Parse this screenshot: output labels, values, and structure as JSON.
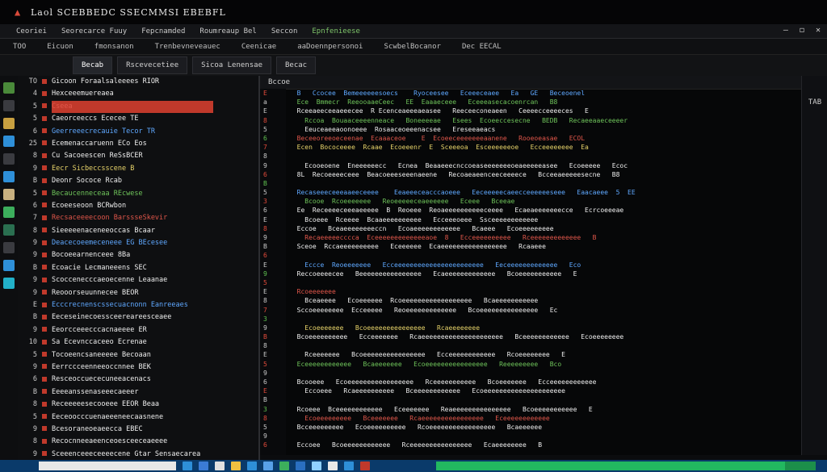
{
  "window": {
    "title": "Laol SCEBBEDC SSECMMSI EBEBFL"
  },
  "menubar": {
    "items": [
      "Ceoriei",
      "Seorecarce Fuuy",
      "Fepcnamded",
      "Roumreaup Bel",
      "Seccon",
      "Epnfenieese"
    ],
    "controls": [
      "—",
      "◻",
      "✕"
    ]
  },
  "toolbar": {
    "items": [
      "TOO",
      "Eicuon",
      "fmonsanon",
      "Trenbevneveauec",
      "Ceenicae",
      "aaDoennpersonoi",
      "ScwbelBocanor",
      "Dec EECAL"
    ]
  },
  "tabs": [
    {
      "label": "Becab",
      "active": true
    },
    {
      "label": "Rscevecetiee",
      "active": false
    },
    {
      "label": "Sicoa Lenensae",
      "active": false
    },
    {
      "label": "Becac",
      "active": false
    }
  ],
  "leftpanel": {
    "lines": [
      {
        "num": "TO",
        "text": "Gicoon  Foraalsaleeees   RIOR",
        "cls": "c-white",
        "hl": false
      },
      {
        "num": "4",
        "text": "Hexceeemuereaea",
        "cls": "c-white",
        "hl": false
      },
      {
        "num": "5",
        "text": "Cseea",
        "cls": "c-red",
        "hl": true
      },
      {
        "num": "5",
        "text": "Caeorceeccs     Ececee  TE",
        "cls": "c-white",
        "hl": false
      },
      {
        "num": "6",
        "text": "Geerreeecrecauie  Tecor  TR",
        "cls": "c-blue",
        "hl": false
      },
      {
        "num": "25",
        "text": "Ecemenaccaruenn   ECo   Eos",
        "cls": "c-white",
        "hl": false
      },
      {
        "num": "8",
        "text": "Cu  Sacoeescen   ReSsBCER",
        "cls": "c-white",
        "hl": false
      },
      {
        "num": "9",
        "text": "Eecr  Sicbeccsscene  B",
        "cls": "c-yellow",
        "hl": false
      },
      {
        "num": "B",
        "text": "Deonr  Sococe  Rcab",
        "cls": "c-white",
        "hl": false
      },
      {
        "num": "5",
        "text": "Becaucenneceaa   REcwese",
        "cls": "c-green",
        "hl": false
      },
      {
        "num": "6",
        "text": "Ecoeeseoon   BCRwbon",
        "cls": "c-white",
        "hl": false
      },
      {
        "num": "7",
        "text": "Recsaceeeecoon   BarssseSkevir",
        "cls": "c-red",
        "hl": false
      },
      {
        "num": "8",
        "text": "Sieeeeenaceneeoccas   Bcaar",
        "cls": "c-white",
        "hl": false
      },
      {
        "num": "9",
        "text": "Deacecoeemeceneee   EG   BEcesee",
        "cls": "c-blue",
        "hl": false
      },
      {
        "num": "9",
        "text": "Bocoeearnenceee   8Ba",
        "cls": "c-white",
        "hl": false
      },
      {
        "num": "B",
        "text": "Ecoacie  Lecmaneeens   SEC",
        "cls": "c-white",
        "hl": false
      },
      {
        "num": "9",
        "text": "Scoccenecccaeoecenne   Leaanae",
        "cls": "c-white",
        "hl": false
      },
      {
        "num": "9",
        "text": "Reooorseuunnecee   BEOR",
        "cls": "c-white",
        "hl": false
      },
      {
        "num": "E",
        "text": "Ecccrecnenscssecuacnonn   Eanreeaes",
        "cls": "c-blue",
        "hl": false
      },
      {
        "num": "B",
        "text": "Eeceseinecoessceereareesceaee",
        "cls": "c-white",
        "hl": false
      },
      {
        "num": "9",
        "text": "Eeorcceeecccacnaeeee   ER",
        "cls": "c-white",
        "hl": false
      },
      {
        "num": "10",
        "text": "Sa  Ecevnccaceeo   Ecrenae",
        "cls": "c-white",
        "hl": false
      },
      {
        "num": "5",
        "text": "Tocoeencsaneeeee   Becoaan",
        "cls": "c-white",
        "hl": false
      },
      {
        "num": "9",
        "text": "Eerrccceenneeoccnnee   BEK",
        "cls": "c-white",
        "hl": false
      },
      {
        "num": "6",
        "text": "Resceoccuececuneeacenacs",
        "cls": "c-white",
        "hl": false
      },
      {
        "num": "B",
        "text": "Eeeeanssenaseeecaeeer",
        "cls": "c-white",
        "hl": false
      },
      {
        "num": "8",
        "text": "Receeeeesecooeee   EEOR   Beaa",
        "cls": "c-white",
        "hl": false
      },
      {
        "num": "5",
        "text": "Eeceoocccuenaeeeneecaasnene",
        "cls": "c-white",
        "hl": false
      },
      {
        "num": "9",
        "text": "Bcesoraneoeaeecca   EBEC",
        "cls": "c-white",
        "hl": false
      },
      {
        "num": "8",
        "text": "Recocnneeaeenceoesceeceaeeee",
        "cls": "c-white",
        "hl": false
      },
      {
        "num": "9",
        "text": "Sceeenceeeceeeecene   Gtar  Sensaecarea",
        "cls": "c-white",
        "hl": false
      }
    ]
  },
  "editor": {
    "header": "Bccoe",
    "gutter": [
      "E",
      "a",
      "E",
      "8",
      "5",
      "6",
      "7",
      "8",
      "9",
      "6",
      "B",
      "5",
      "3",
      "6",
      "E",
      "8",
      "9",
      "B",
      "6",
      "E",
      "9",
      "5",
      "E",
      "8",
      "7",
      "3",
      "9",
      "B",
      "8",
      "E",
      "5",
      "9",
      "6",
      "E",
      "B",
      "3",
      "8",
      "5",
      "9",
      "6"
    ],
    "lines": [
      {
        "text": "  B   Ccocee  Bemeeeeeesoecs    Ryoceesee   Eceeeceaee   Ea   GE   Beceoenel",
        "cls": "c-blue"
      },
      {
        "text": "  Ece  Bmmecr  ReeooaaeCeec   EE  Eaaaeceee   Eceeeasecacoenrcan   B8",
        "cls": "c-green"
      },
      {
        "text": "  Rceeaeeceeaeeecee  R Ecenceaeeeaeasee   Reeceeconeaeen   Ceeeecceeeeces   E",
        "cls": "c-white"
      },
      {
        "text": "    Rccoa  Bouaaceeeenneace   Boneeeeae   Esees  Ecoeeccesecne   BEDB   Recaeeaaeceeeer",
        "cls": "c-green"
      },
      {
        "text": "    Eeuceaeeaoonoeee  Rosaaceoeeenacsee   Ereseeaeacs",
        "cls": "c-white"
      },
      {
        "text": "  Beceeoreeoeceenae  Ecaaaceoe    E  Ecoeeceeeeeeeaanene   Rooeoeasae   ECOL",
        "cls": "c-red"
      },
      {
        "text": "  Ecen  Bococeeee  Rcaae  Ecoeeenr  E  Sceeeoa  Esceeeeeeoe   Ecceeeeeeee  Ea",
        "cls": "c-yellow"
      },
      {
        "text": "",
        "cls": "c-white"
      },
      {
        "text": "    Ecooeoene  Eneeeeeecc   Ecnea  Beaaeeecnccoeaseeeeeeeoeaeeeeeasee   Ecoeeeee   Ecoc",
        "cls": "c-white"
      },
      {
        "text": "  8L  Recoeeeeceee  Beacoeeeseeenaeene   Recoaeaeenceeceeeece   Bcceeaeeeeesecne   B8",
        "cls": "c-white"
      },
      {
        "text": "",
        "cls": "c-white"
      },
      {
        "text": "  Recaseeeceeeaaeeceeee    Eeaeeeceacccaoeee   Eeceeeeecaeecceeeeeeseee   Eaacaeee  5  EE",
        "cls": "c-blue"
      },
      {
        "text": "    Bcooe  Rcoeeeeeee   Reoeeeeeceaeeeeee   Eceee   Bceeae",
        "cls": "c-green"
      },
      {
        "text": "  Ee  Receeeeceeeaeeeee  B  Reoeee  Reoaeeeeeeeeeeceeee   Ecaeaeeeeeeecce   Ecrcoeeeae",
        "cls": "c-white"
      },
      {
        "text": "    Bcoeee  Rceeee  Bcaaeeeeeeeeee   Ecceeeoeee  Ssceeeeeeeeeeee",
        "cls": "c-white"
      },
      {
        "text": "  Eccoe   Bceaeeeeeeeeccn   Ecoaeeeeeeeeeeee   Bcaeee   Ecoeeeeeeeee",
        "cls": "c-white"
      },
      {
        "text": "    Recaeeeeecccca  Eceeeeeeeeeeeeeaoe  8   Ecceeeeeeeeee   Rceeeeeeeeeeeee   B",
        "cls": "c-red"
      },
      {
        "text": "  Sceoe  Rccaeeeeeeeeee   Eceeeeee  Ecaeeeeeeeeeeeeeeeee   Rcaaeee",
        "cls": "c-white"
      },
      {
        "text": "",
        "cls": "c-white"
      },
      {
        "text": "    Eccce  Reoeeeeeee   Ecceeeeeeeeeeeeeeeeeeeeeee   Eeceeeeeeeeeeeee   Eco",
        "cls": "c-blue"
      },
      {
        "text": "  Reccoeeeecee   Beeeeeeeeeeeeeeee   Ecaeeeeeeeeeeeee   Bcoeeeeeeeeeee   E",
        "cls": "c-white"
      },
      {
        "text": "",
        "cls": "c-white"
      },
      {
        "text": "  Rcoeeeeeee",
        "cls": "c-red"
      },
      {
        "text": "    Bceaeeee   Ecoeeeeee  Rcoeeeeeeeeeeeeeeeeee   Bcaeeeeeeeeeee",
        "cls": "c-white"
      },
      {
        "text": "  Sccoeeeeeeee  Ecceeeee   Reoeeeeeeeeeeeee   Bcoeeeeeeeeeeeeeee   Ec",
        "cls": "c-white"
      },
      {
        "text": "",
        "cls": "c-white"
      },
      {
        "text": "    Ecoeeeeeee   Bcoeeeeeeeeeeeeeee   Rcaeeeeeeee",
        "cls": "c-yellow"
      },
      {
        "text": "  Bcoeeeeeeeeee   Ecceeeeeee   Rcaeeeeeeeeeeeeeeeeeeeee   Bceeeeeeeeeeee   Ecoeeeeeeee",
        "cls": "c-white"
      },
      {
        "text": "",
        "cls": "c-white"
      },
      {
        "text": "    Rceeeeeee   Bcoeeeeeeeeeeeeeeee   Ecceeeeeeeeeeee   Rcoeeeeeeee   E",
        "cls": "c-white"
      },
      {
        "text": "  Eceeeeeeeeeeee   Bcaeeeeeee   Ecoeeeeeeeeeeeeeeee   Reeeeeeeee   Bco",
        "cls": "c-green"
      },
      {
        "text": "",
        "cls": "c-white"
      },
      {
        "text": "  Bcooeee   Ecoeeeeeeeeeeeeeeeee   Rceeeeeeeeeee   Bcoeeeeeee   Ecceeeeeeeeeeee",
        "cls": "c-white"
      },
      {
        "text": "    Eccoeee   Rcaeeeeeeeeee   Bceeeeeeeeeeee   Ecoeeeeeeeeeeeeeeeeeeeee",
        "cls": "c-white"
      },
      {
        "text": "",
        "cls": "c-white"
      },
      {
        "text": "  Rcoeee  Bceeeeeeeeeeee   Eceeeeeee   Reaeeeeeeeeeeeeeee   Bcoeeeeeeeeeee   E",
        "cls": "c-white"
      },
      {
        "text": "    Ecoeeeeeeeee   Bceeeeeee   Rcaeeeeeeeeeeeeeeee   Eceeeeeeeeeeee",
        "cls": "c-red"
      },
      {
        "text": "  Bcceeeeeeeee   Ecoeeeeeeeeee   Rcoeeeeeeeeeeeeeeeee   Bcaeeeeee",
        "cls": "c-white"
      },
      {
        "text": "",
        "cls": "c-white"
      },
      {
        "text": "  Eccoee   Bcoeeeeeeeeeeee   Rceeeeeeeeeeeeeeee   Ecaeeeeeeee   B",
        "cls": "c-white"
      }
    ]
  },
  "rightpanel": {
    "label": "TAB"
  },
  "taskbar": {
    "progress": 0.92,
    "apps": [
      "#2e8fd8",
      "#3b7bd4",
      "#e0e0e0",
      "#f0c040",
      "#2e8fd8",
      "#58a0e8",
      "#3cae5c",
      "#2a6fc0",
      "#8fd0ff",
      "#e8e8e8",
      "#2e8fd8",
      "#c0392b"
    ]
  },
  "colors": {
    "accent": "#c0392b",
    "taskbar": "#0a3a6a",
    "progress": "#22b860"
  }
}
